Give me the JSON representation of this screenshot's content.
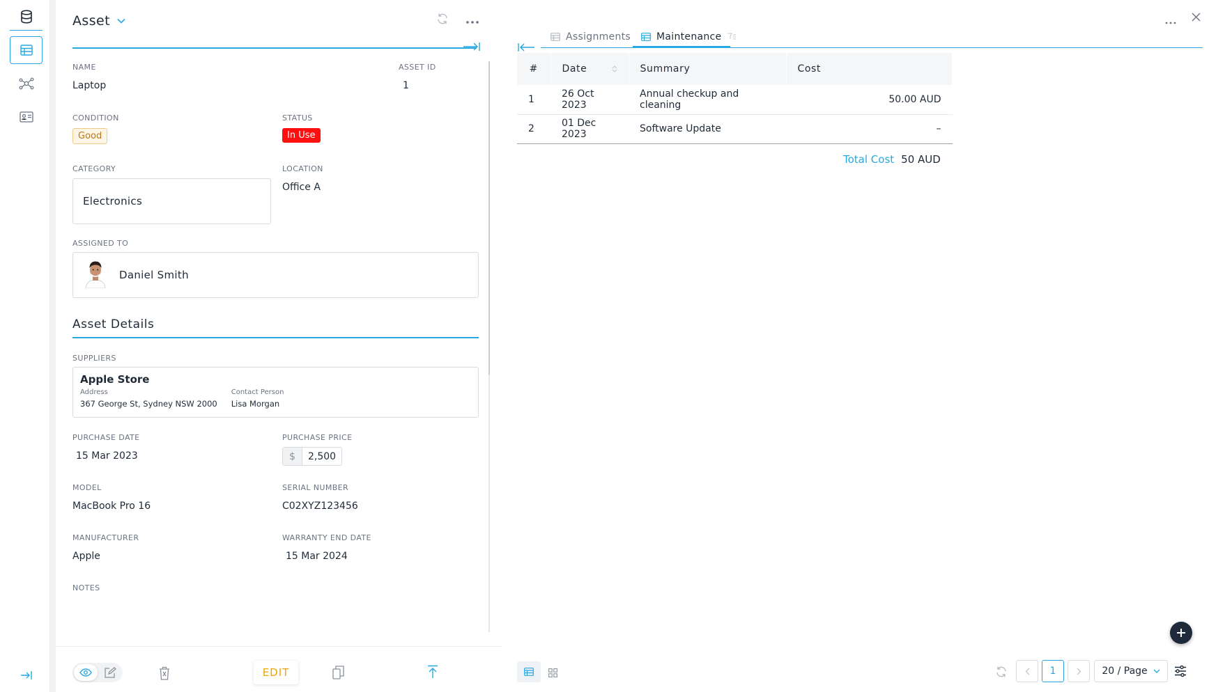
{
  "card": {
    "title": "Asset",
    "fields": {
      "name": {
        "label": "NAME",
        "value": "Laptop"
      },
      "asset_id": {
        "label": "ASSET ID",
        "value": "1"
      },
      "condition": {
        "label": "CONDITION",
        "value": "Good"
      },
      "status": {
        "label": "STATUS",
        "value": "In Use"
      },
      "category": {
        "label": "CATEGORY",
        "value": "Electronics"
      },
      "location": {
        "label": "LOCATION",
        "value": "Office A"
      },
      "assigned_to": {
        "label": "ASSIGNED TO",
        "value": "Daniel Smith"
      }
    },
    "section_title": "Asset Details",
    "suppliers": {
      "label": "SUPPLIERS",
      "name": "Apple Store",
      "address_label": "Address",
      "address": "367 George St, Sydney NSW 2000",
      "contact_label": "Contact Person",
      "contact": "Lisa Morgan"
    },
    "details": {
      "purchase_date": {
        "label": "PURCHASE DATE",
        "value": "15 Mar 2023"
      },
      "purchase_price": {
        "label": "PURCHASE PRICE",
        "currency": "$",
        "value": "2,500"
      },
      "model": {
        "label": "MODEL",
        "value": "MacBook Pro 16"
      },
      "serial_number": {
        "label": "SERIAL NUMBER",
        "value": "C02XYZ123456"
      },
      "manufacturer": {
        "label": "MANUFACTURER",
        "value": "Apple"
      },
      "warranty_end_date": {
        "label": "WARRANTY END DATE",
        "value": "15 Mar 2024"
      },
      "notes": {
        "label": "NOTES",
        "value": ""
      }
    },
    "footer": {
      "edit_label": "EDIT"
    }
  },
  "right": {
    "tabs": [
      {
        "label": "Assignments",
        "active": false
      },
      {
        "label": "Maintenance",
        "active": true
      }
    ],
    "table": {
      "headers": [
        "#",
        "Date",
        "Summary",
        "Cost"
      ],
      "rows": [
        {
          "n": "1",
          "date": "26 Oct 2023",
          "summary": "Annual checkup and cleaning",
          "cost": "50.00 AUD"
        },
        {
          "n": "2",
          "date": "01 Dec 2023",
          "summary": "Software Update",
          "cost": "–"
        }
      ]
    },
    "total_label": "Total Cost",
    "total_value": "50 AUD",
    "pagination": {
      "current_page": "1",
      "page_size": "20 / Page"
    }
  },
  "colors": {
    "accent": "#27a8e0",
    "status_in_use": "#ff1010",
    "condition_good": "#b7791f",
    "edit": "#f0a500"
  }
}
